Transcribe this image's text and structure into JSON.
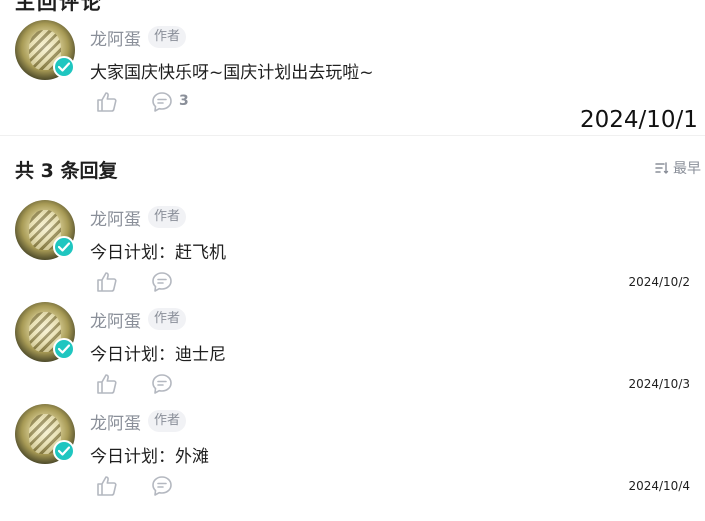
{
  "top_title_clipped": "主回评论",
  "main_comment": {
    "username": "龙阿蛋",
    "tag": "作者",
    "content": "大家国庆快乐呀~国庆计划出去玩啦~",
    "reply_count": "3",
    "date": "2024/10/1"
  },
  "replies_header": {
    "title": "共 3 条回复",
    "sort_label": "最早"
  },
  "replies": [
    {
      "username": "龙阿蛋",
      "tag": "作者",
      "content": "今日计划：赶飞机",
      "date": "2024/10/2"
    },
    {
      "username": "龙阿蛋",
      "tag": "作者",
      "content": "今日计划：迪士尼",
      "date": "2024/10/3"
    },
    {
      "username": "龙阿蛋",
      "tag": "作者",
      "content": "今日计划：外滩",
      "date": "2024/10/4"
    }
  ],
  "icons": {
    "like": "thumbs-up-icon",
    "reply": "comment-icon",
    "verified": "verified-check-icon",
    "sort": "sort-icon"
  },
  "colors": {
    "verified": "#1fc6c0",
    "muted_text": "#8a8f99",
    "primary_text": "#1f1f1f"
  }
}
